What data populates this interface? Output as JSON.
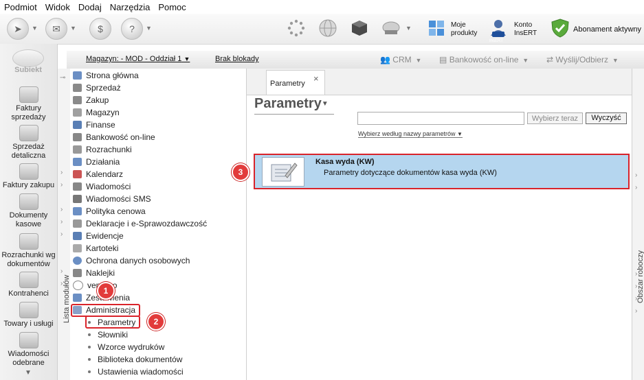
{
  "menu": [
    "Podmiot",
    "Widok",
    "Dodaj",
    "Narzędzia",
    "Pomoc"
  ],
  "toolbar": {
    "moje_produkty": "Moje\nprodukty",
    "konto_insert": "Konto\nInsERT",
    "abonament": "Abonament aktywny",
    "insert_logo": "InsERT"
  },
  "app": {
    "logo": "Subiekt"
  },
  "leftnav": [
    {
      "label": "Faktury\nsprzedaży"
    },
    {
      "label": "Sprzedaż\ndetaliczna"
    },
    {
      "label": "Faktury zakupu"
    },
    {
      "label": "Dokumenty\nkasowe"
    },
    {
      "label": "Rozrachunki wg\ndokumentów"
    },
    {
      "label": "Kontrahenci"
    },
    {
      "label": "Towary i usługi"
    },
    {
      "label": "Wiadomości\nodebrane"
    }
  ],
  "bar2": {
    "magazyn": "Magazyn: - MOD - Oddział 1",
    "brak_blokady": "Brak blokady",
    "crm": "CRM",
    "bankowosc": "Bankowość on-line",
    "wyslij": "Wyślij/Odbierz"
  },
  "side_labels": {
    "modules": "Lista modułów",
    "workspace": "Obszar roboczy"
  },
  "tree": [
    "Strona główna",
    "Sprzedaż",
    "Zakup",
    "Magazyn",
    "Finanse",
    "Bankowość on-line",
    "Rozrachunki",
    "Działania",
    "Kalendarz",
    "Wiadomości",
    "Wiadomości SMS",
    "Polityka cenowa",
    "Deklaracje i e-Sprawozdawczość",
    "Ewidencje",
    "Kartoteki",
    "Ochrona danych osobowych",
    "Naklejki",
    "vendero",
    "Zestawienia",
    "Administracja"
  ],
  "tree_icon_color": "#6b8fc4",
  "subtree": [
    "Parametry",
    "Słowniki",
    "Wzorce wydruków",
    "Biblioteka dokumentów",
    "Ustawienia wiadomości"
  ],
  "main": {
    "tab": "Parametry",
    "tab_close": "×",
    "title": "Parametry",
    "search_button": "Wybierz teraz",
    "clear_button": "Wyczyść",
    "filter_link": "Wybierz według nazwy parametrów",
    "result_title": "Kasa wyda (KW)",
    "result_desc": "Parametry dotyczące dokumentów kasa wyda (KW)"
  },
  "badges": [
    "1",
    "2",
    "3"
  ],
  "colors": {
    "highlight": "#d9232a",
    "selection": "#b5d6ef",
    "badge": "#e23b3b"
  }
}
